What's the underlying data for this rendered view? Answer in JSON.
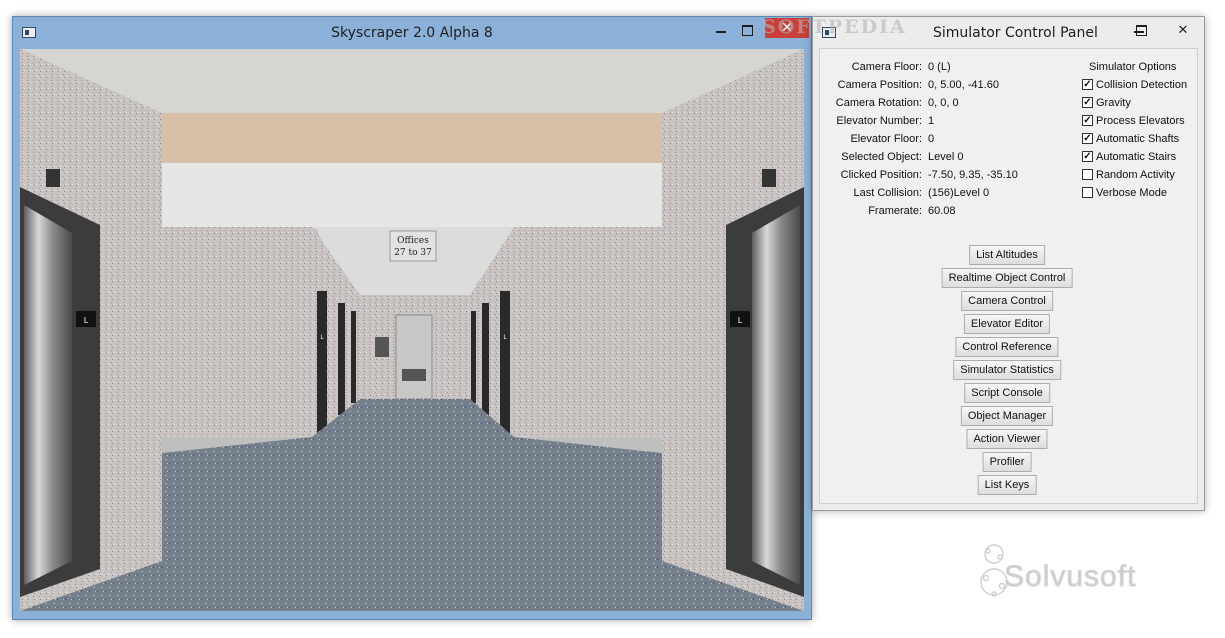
{
  "sky_window": {
    "title": "Skyscraper 2.0 Alpha 8",
    "controls": {
      "minimize": "—",
      "maximize": "□",
      "close": "✕"
    },
    "scene": {
      "sign_line1": "Offices",
      "sign_line2": "27 to 37",
      "left_panel_label": "L",
      "right_panel_label": "L",
      "hall_left_label": "L",
      "hall_right_label": "L"
    }
  },
  "control_panel": {
    "title": "Simulator Control Panel",
    "info": [
      {
        "label": "Camera Floor:",
        "value": "0 (L)"
      },
      {
        "label": "Camera Position:",
        "value": "0, 5.00, -41.60"
      },
      {
        "label": "Camera Rotation:",
        "value": "0, 0, 0"
      },
      {
        "label": "Elevator Number:",
        "value": "1"
      },
      {
        "label": "Elevator Floor:",
        "value": "0"
      },
      {
        "label": "Selected Object:",
        "value": "Level 0"
      },
      {
        "label": "Clicked Position:",
        "value": "-7.50, 9.35, -35.10"
      },
      {
        "label": "Last Collision:",
        "value": "(156)Level 0"
      },
      {
        "label": "Framerate:",
        "value": "60.08"
      }
    ],
    "options_title": "Simulator Options",
    "options": [
      {
        "label": "Collision Detection",
        "checked": true
      },
      {
        "label": "Gravity",
        "checked": true
      },
      {
        "label": "Process Elevators",
        "checked": true
      },
      {
        "label": "Automatic Shafts",
        "checked": true
      },
      {
        "label": "Automatic Stairs",
        "checked": true
      },
      {
        "label": "Random Activity",
        "checked": false
      },
      {
        "label": "Verbose Mode",
        "checked": false
      }
    ],
    "buttons": [
      "List Altitudes",
      "Realtime Object Control",
      "Camera Control",
      "Elevator Editor",
      "Control Reference",
      "Simulator Statistics",
      "Script Console",
      "Object Manager",
      "Action Viewer",
      "Profiler",
      "List Keys"
    ]
  },
  "watermarks": {
    "softpedia": "SOFTPEDIA",
    "solvusoft": "Solvusoft"
  },
  "colors": {
    "window_frame": "#8cb1d9",
    "close_red": "#c9403a",
    "panel_bg": "#f0f0f0"
  }
}
